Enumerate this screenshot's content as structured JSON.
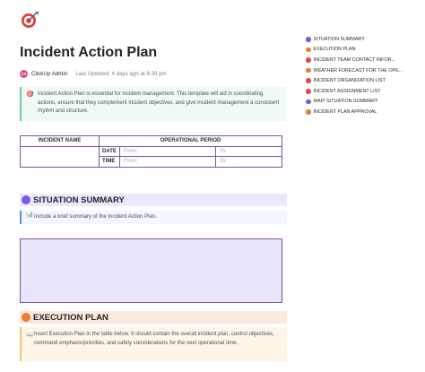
{
  "document": {
    "title": "Incident Action Plan",
    "author": "ClickUp Admin",
    "author_initials": "CA",
    "last_updated": "Last Updated: 4 days ago at 8:39 pm",
    "intro": "Incident Action Plan is essential for incident management. This template will aid in coordinating actions, ensure that they complement incident objectives, and give incident management a consistent rhythm and structure."
  },
  "table": {
    "col1": "INCIDENT NAME",
    "col2": "OPERATIONAL PERIOD",
    "date_label": "DATE",
    "time_label": "TIME",
    "from": "From:",
    "to": "To:"
  },
  "situation": {
    "heading": "SITUATION SUMMARY",
    "note": "Include a brief summary of the Incident Action Plan."
  },
  "execution": {
    "heading": "EXECUTION PLAN",
    "note": "Insert Execution Plan in the table below. It should contain the overall incident plan, control objectives, command emphasis/priorities, and safety considerations for the next operational time."
  },
  "toc": [
    {
      "label": "SITUATION SUMMARY",
      "color": "#7b5ce0"
    },
    {
      "label": "EXECUTION PLAN",
      "color": "#f07a30"
    },
    {
      "label": "INCIDENT TEAM CONTACT INFOR...",
      "color": "#e8484a"
    },
    {
      "label": "WEATHER FORECAST FOR THE OPE...",
      "color": "#f07a30"
    },
    {
      "label": "INCIDENT ORGANIZATION LIST",
      "color": "#e8484a"
    },
    {
      "label": "INCIDENT ASSIGNMENT LIST",
      "color": "#e8484a"
    },
    {
      "label": "MAP/ SITUATION SUMMARY",
      "color": "#7b5ce0"
    },
    {
      "label": "INCIDENT PLAN APPROVAL",
      "color": "#f07a30"
    }
  ],
  "colors": {
    "accent_purple": "#7b5ce0",
    "accent_orange": "#f07a30",
    "table_border": "#8a4f9e"
  },
  "icons": {
    "logo": "target-dart-icon",
    "intro": "target-dart-icon",
    "situation_note": "chart-icon",
    "execution_note": "book-icon"
  }
}
